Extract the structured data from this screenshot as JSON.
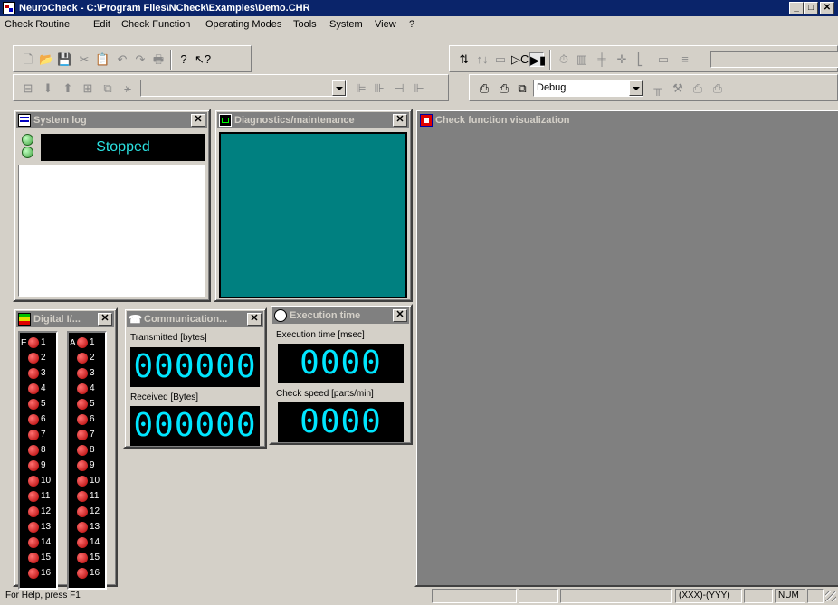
{
  "window": {
    "title": "NeuroCheck - C:\\Program Files\\NCheck\\Examples\\Demo.CHR",
    "minimize": "_",
    "maximize": "□",
    "close": "✕"
  },
  "menu": [
    "Check Routine",
    "Edit",
    "Check Function",
    "Operating Modes",
    "Tools",
    "System",
    "View",
    "?"
  ],
  "toolbar": {
    "mode_combo": "Debug",
    "name_combo": "",
    "right_combo": ""
  },
  "panels": {
    "system_log": {
      "title": "System log",
      "status": "Stopped"
    },
    "diagnostics": {
      "title": "Diagnostics/maintenance",
      "screen_color": "#008080"
    },
    "visualization": {
      "title": "Check function visualization"
    },
    "digital_io": {
      "title": "Digital I/...",
      "input_label": "E",
      "output_label": "A",
      "inputs": [
        "1",
        "2",
        "3",
        "4",
        "5",
        "6",
        "7",
        "8",
        "9",
        "10",
        "11",
        "12",
        "13",
        "14",
        "15",
        "16"
      ],
      "outputs": [
        "1",
        "2",
        "3",
        "4",
        "5",
        "6",
        "7",
        "8",
        "9",
        "10",
        "11",
        "12",
        "13",
        "14",
        "15",
        "16"
      ]
    },
    "communication": {
      "title": "Communication...",
      "transmitted_label": "Transmitted [bytes]",
      "transmitted_value": "000000",
      "received_label": "Received [Bytes]",
      "received_value": "000000"
    },
    "execution_time": {
      "title": "Execution time",
      "time_label": "Execution time [msec]",
      "time_value": "0000",
      "speed_label": "Check speed [parts/min]",
      "speed_value": "0000"
    }
  },
  "statusbar": {
    "help": "For Help, press F1",
    "position": "(XXX)-(YYY)",
    "num": "NUM"
  },
  "colors": {
    "title_bar": "#0a246a",
    "inactive_caption": "#808080",
    "led_red": "#d00000",
    "lcd_cyan": "#00e6ff"
  }
}
